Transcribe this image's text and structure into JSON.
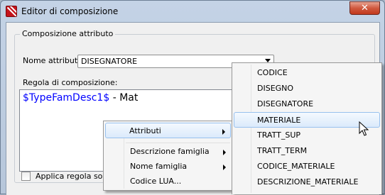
{
  "window": {
    "title": "Editor di composizione",
    "close_glyph": "✕"
  },
  "group": {
    "label": "Composizione attributo"
  },
  "nome_attributo": {
    "label": "Nome attributo",
    "value": "DISEGNATORE"
  },
  "regola": {
    "label": "Regola di composizione:",
    "text_var": "$TypeFamDesc1$",
    "text_rest": " - Mat"
  },
  "checkbox": {
    "label": "Applica regola solo se",
    "checked": false
  },
  "context_menu": {
    "items": [
      {
        "label": "Attributi",
        "has_submenu": true
      },
      {
        "label": "Descrizione famiglia",
        "has_submenu": true
      },
      {
        "label": "Nome famiglia",
        "has_submenu": true
      },
      {
        "label": "Codice LUA...",
        "has_submenu": false
      }
    ]
  },
  "submenu": {
    "items": [
      "CODICE",
      "DISEGNO",
      "DISEGNATORE",
      "MATERIALE",
      "TRATT_SUP",
      "TRATT_TERM",
      "CODICE_MATERIALE",
      "DESCRIZIONE_MATERIALE"
    ],
    "highlighted": "MATERIALE"
  },
  "icons": {
    "app": "app-logo-icon",
    "dropdown": "chevron-down-icon",
    "submenu": "chevron-right-icon",
    "cursor": "mouse-pointer-icon"
  }
}
